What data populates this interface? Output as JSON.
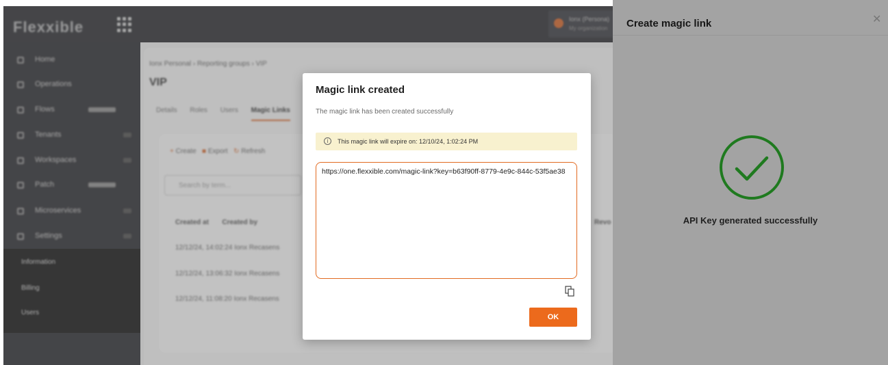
{
  "app": {
    "brand": "Flexxible"
  },
  "topbar": {
    "user_name": "Ionx (Persona)",
    "user_org": "My organization"
  },
  "sidebar": {
    "items": [
      {
        "label": "Home"
      },
      {
        "label": "Operations"
      },
      {
        "label": "Flows"
      },
      {
        "label": "Tenants"
      },
      {
        "label": "Workspaces"
      },
      {
        "label": "Patch"
      },
      {
        "label": "Microservices"
      },
      {
        "label": "Settings"
      }
    ],
    "subitems": [
      {
        "label": "Information"
      },
      {
        "label": "Billing"
      },
      {
        "label": "Users"
      }
    ]
  },
  "main": {
    "breadcrumb": "Ionx Personal  ›  Reporting groups  ›  VIP",
    "title": "VIP",
    "tabs": [
      "Details",
      "Roles",
      "Users",
      "Magic Links"
    ],
    "toolbar": {
      "create": "Create",
      "export": "Export",
      "refresh": "Refresh"
    },
    "search_placeholder": "Search by term...",
    "columns": [
      "Created at",
      "Created by"
    ],
    "right_column": "Revo",
    "rows": [
      {
        "created_at": "12/12/24, 14:02:24",
        "created_by": "Ionx Recasens"
      },
      {
        "created_at": "12/12/24, 13:06:32",
        "created_by": "Ionx Recasens"
      },
      {
        "created_at": "12/12/24, 11:08:20",
        "created_by": "Ionx Recasens"
      }
    ]
  },
  "right_panel": {
    "title": "Create magic link",
    "close_icon": "close-icon",
    "success_message": "API Key generated successfully",
    "check_color": "#1f7a1f"
  },
  "modal": {
    "title": "Magic link created",
    "subtitle": "The magic link has been created successfully",
    "warning": "This magic link will expire on: 12/10/24, 1:02:24 PM",
    "link": "https://one.flexxible.com/magic-link?key=b63f90ff-8779-4e9c-844c-53f5ae38",
    "ok_label": "OK",
    "accent": "#ec6a1c"
  }
}
